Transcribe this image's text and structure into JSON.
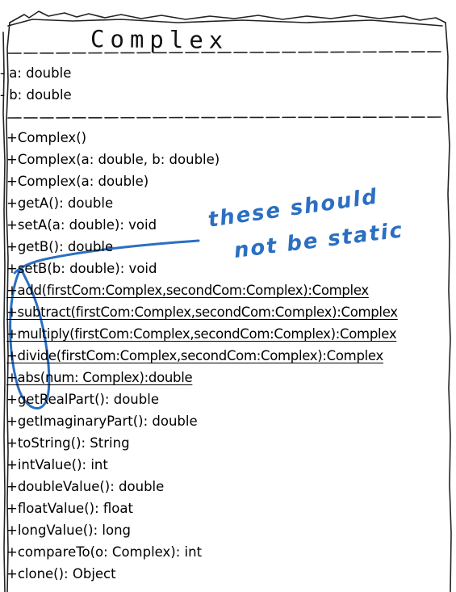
{
  "class_name": "Complex",
  "attributes": [
    " - a: double",
    "- b: double"
  ],
  "operations": [
    {
      "text": "+Complex()",
      "static": false
    },
    {
      "text": "+Complex(a: double, b: double)",
      "static": false
    },
    {
      "text": "+Complex(a: double)",
      "static": false
    },
    {
      "text": "+getA(): double",
      "static": false
    },
    {
      "text": "+setA(a: double): void",
      "static": false
    },
    {
      "text": "+getB(): double",
      "static": false
    },
    {
      "text": "+setB(b: double): void",
      "static": false
    },
    {
      "text": "+add(firstCom:Complex,secondCom:Complex):Complex",
      "static": true
    },
    {
      "text": "+subtract(firstCom:Complex,secondCom:Complex):Complex",
      "static": true
    },
    {
      "text": "+multiply(firstCom:Complex,secondCom:Complex):Complex",
      "static": true
    },
    {
      "text": "+divide(firstCom:Complex,secondCom:Complex):Complex",
      "static": true
    },
    {
      "text": "+abs(num: Complex):double",
      "static": true
    },
    {
      "text": "+getRealPart(): double",
      "static": false
    },
    {
      "text": "+getImaginaryPart(): double",
      "static": false
    },
    {
      "text": "+toString(): String",
      "static": false
    },
    {
      "text": "+intValue(): int",
      "static": false
    },
    {
      "text": "+doubleValue(): double",
      "static": false
    },
    {
      "text": "+floatValue(): float",
      "static": false
    },
    {
      "text": "+longValue(): long",
      "static": false
    },
    {
      "text": "+compareTo(o: Complex): int",
      "static": false
    },
    {
      "text": "+clone(): Object",
      "static": false
    }
  ],
  "annotation": {
    "line1": "these should",
    "line2": "not be static",
    "color": "#2b6fc2"
  }
}
